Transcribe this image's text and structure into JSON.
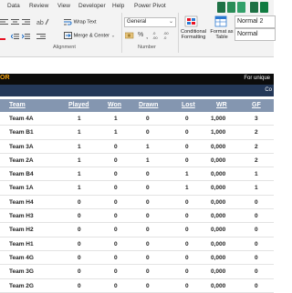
{
  "menu": {
    "tabs": [
      "Data",
      "Review",
      "View",
      "Developer",
      "Help",
      "Power Pivot"
    ]
  },
  "ribbon": {
    "wrap_text": "Wrap Text",
    "merge_center": "Merge & Center",
    "alignment_label": "Alignment",
    "number_format": "General",
    "number_label": "Number",
    "conditional_formatting": [
      "Conditional",
      "Formatting"
    ],
    "format_as_table": [
      "Format as",
      "Table"
    ],
    "style_normal2": "Normal 2",
    "style_normal": "Normal"
  },
  "sheet": {
    "title_fragment": "OR",
    "note_fragment": "For unique",
    "sub_fragment": "Co",
    "columns": [
      "Team",
      "Played",
      "Won",
      "Drawn",
      "Lost",
      "WR",
      "GF"
    ],
    "rows": [
      [
        "Team 4A",
        "1",
        "1",
        "0",
        "0",
        "1,000",
        "3"
      ],
      [
        "Team B1",
        "1",
        "1",
        "0",
        "0",
        "1,000",
        "2"
      ],
      [
        "Team 3A",
        "1",
        "0",
        "1",
        "0",
        "0,000",
        "2"
      ],
      [
        "Team 2A",
        "1",
        "0",
        "1",
        "0",
        "0,000",
        "2"
      ],
      [
        "Team B4",
        "1",
        "0",
        "0",
        "1",
        "0,000",
        "1"
      ],
      [
        "Team 1A",
        "1",
        "0",
        "0",
        "1",
        "0,000",
        "1"
      ],
      [
        "Team H4",
        "0",
        "0",
        "0",
        "0",
        "0,000",
        "0"
      ],
      [
        "Team H3",
        "0",
        "0",
        "0",
        "0",
        "0,000",
        "0"
      ],
      [
        "Team H2",
        "0",
        "0",
        "0",
        "0",
        "0,000",
        "0"
      ],
      [
        "Team H1",
        "0",
        "0",
        "0",
        "0",
        "0,000",
        "0"
      ],
      [
        "Team 4G",
        "0",
        "0",
        "0",
        "0",
        "0,000",
        "0"
      ],
      [
        "Team 3G",
        "0",
        "0",
        "0",
        "0",
        "0,000",
        "0"
      ],
      [
        "Team 2G",
        "0",
        "0",
        "0",
        "0",
        "0,000",
        "0"
      ]
    ]
  },
  "colors": {
    "header_bg": "#8496b0",
    "title_bg": "#0c0c0c",
    "title_accent": "#f5a10b",
    "sub_bg": "#243858"
  }
}
